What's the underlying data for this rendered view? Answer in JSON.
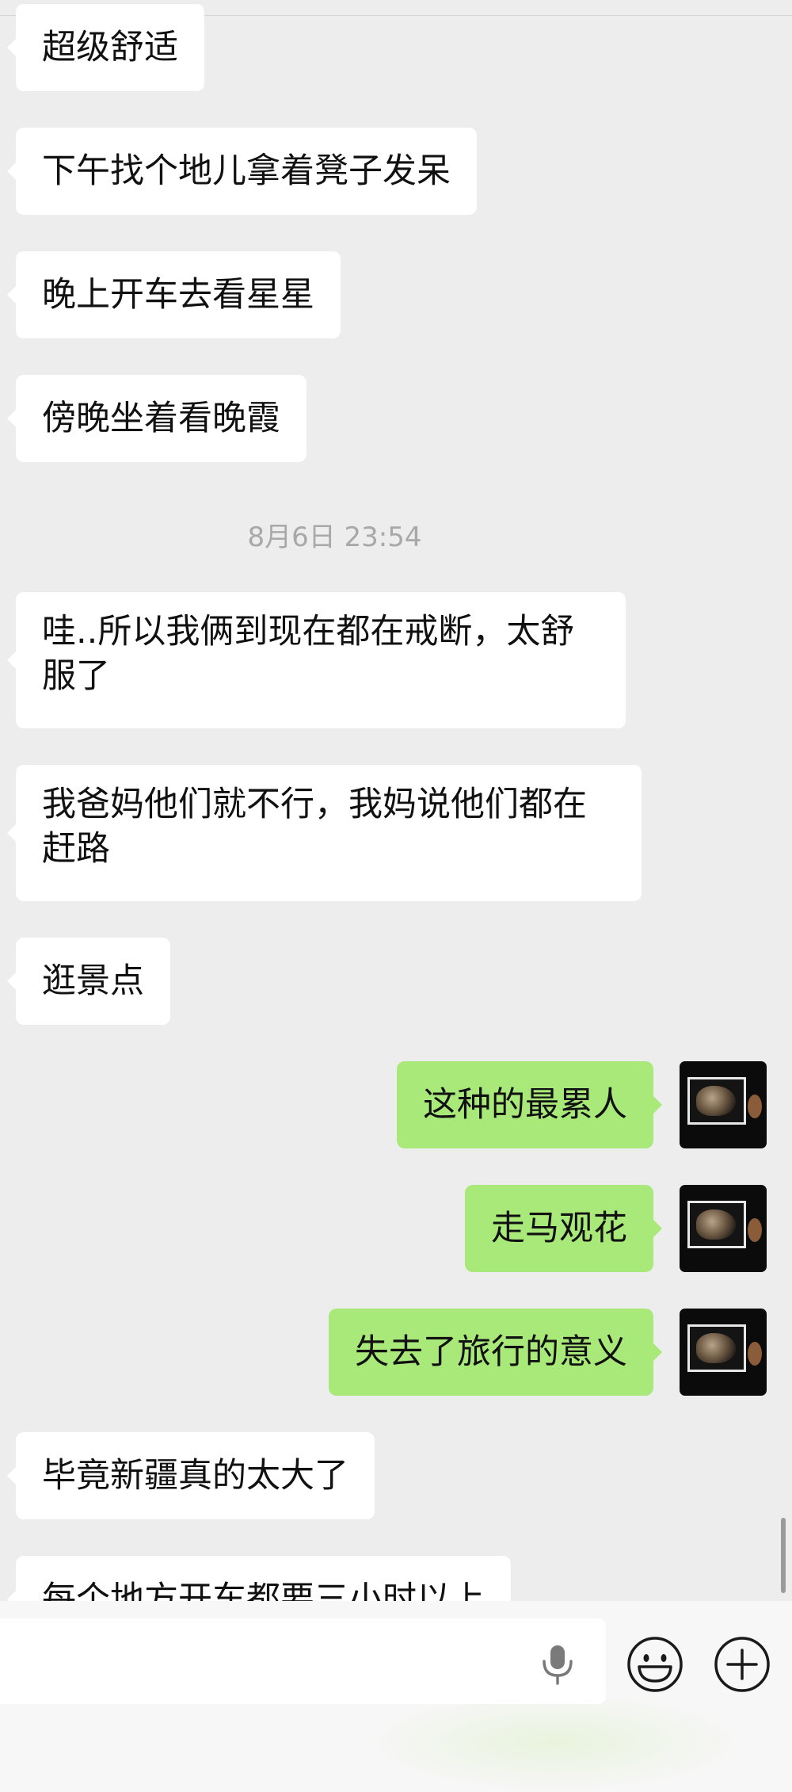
{
  "messages_top": [
    {
      "text": "超级舒适"
    },
    {
      "text": "下午找个地儿拿着凳子发呆"
    },
    {
      "text": "晚上开车去看星星"
    },
    {
      "text": "傍晚坐着看晚霞"
    }
  ],
  "timestamp": "8月6日 23:54",
  "messages_mid": [
    {
      "line1": "哇..所以我俩到现在都在戒断，太舒",
      "line2": "服了"
    },
    {
      "line1": "我爸妈他们就不行，我妈说他们都在",
      "line2": "赶路"
    },
    {
      "text": "逛景点"
    }
  ],
  "messages_out": [
    {
      "text": "这种的最累人"
    },
    {
      "text": "走马观花"
    },
    {
      "text": "失去了旅行的意义"
    }
  ],
  "messages_bottom": [
    {
      "text": "毕竟新疆真的太大了"
    },
    {
      "text": "每个地方开车都要三小时以上"
    }
  ],
  "icons": {
    "avatar": "avatar-icon",
    "voice": "microphone-icon",
    "emoji": "emoji-icon",
    "more": "plus-icon"
  },
  "colors": {
    "background": "#ededed",
    "incoming_bubble": "#ffffff",
    "outgoing_bubble": "#a9e97a",
    "timestamp": "#a8a8a8"
  }
}
